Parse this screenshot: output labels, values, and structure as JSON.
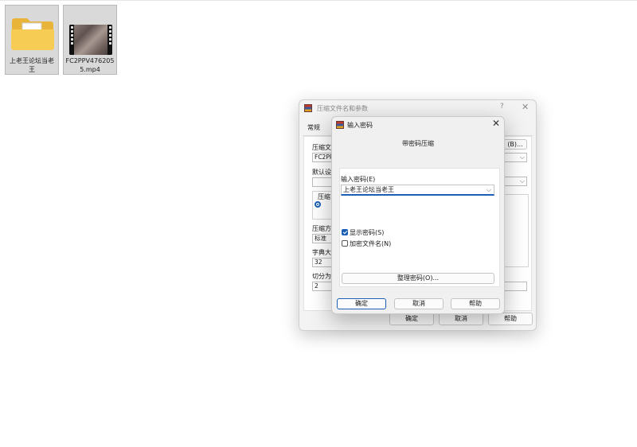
{
  "desktop": {
    "folder": {
      "label": "上老王论坛当老王",
      "icon": "folder-icon"
    },
    "video": {
      "label": "FC2PPV4762055.mp4",
      "icon": "video-thumbnail"
    }
  },
  "archive_dialog": {
    "title": "压缩文件名和参数",
    "help_glyph": "?",
    "close_glyph": "✕",
    "tab_general": "常规",
    "archive_name_label": "压缩文",
    "archive_name_value": "FC2PPV",
    "browse_button": "(B)...",
    "default_profile_label": "默认设",
    "format_label": "压缩",
    "method_label": "压缩方",
    "method_value": "标准",
    "dict_label": "字典大",
    "dict_value": "32",
    "split_label": "切分为",
    "split_value": "2",
    "ok_button": "确定",
    "cancel_button": "取消",
    "help_button": "帮助"
  },
  "password_dialog": {
    "title": "输入密码",
    "close_glyph": "✕",
    "caption": "带密码压缩",
    "password_label": "输入密码(E)",
    "password_value": "上老王论坛当老王",
    "show_password_label": "显示密码(S)",
    "show_password_checked": true,
    "encrypt_names_label": "加密文件名(N)",
    "encrypt_names_checked": false,
    "organize_button": "整理密码(O)...",
    "ok_button": "确定",
    "cancel_button": "取消",
    "help_button": "帮助"
  }
}
